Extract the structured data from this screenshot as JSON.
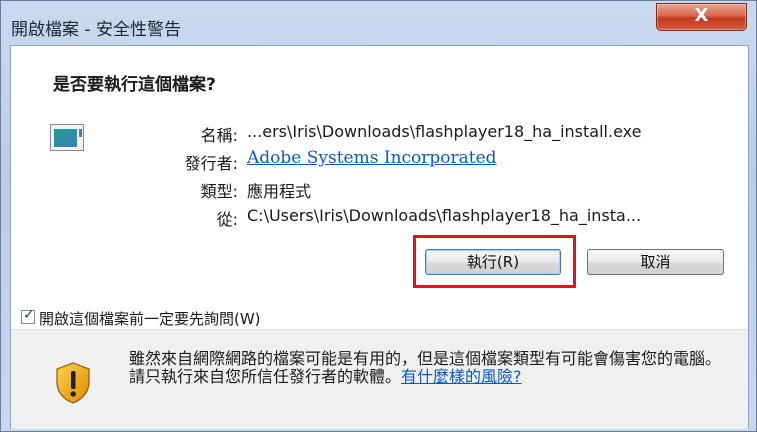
{
  "window": {
    "title": "開啟檔案 - 安全性警告",
    "close_label": "X"
  },
  "dialog": {
    "heading": "是否要執行這個檔案?",
    "file_icon": "application-window-icon",
    "fields": {
      "name_label": "名稱:",
      "name_value": "...ers\\Iris\\Downloads\\flashplayer18_ha_install.exe",
      "publisher_label": "發行者:",
      "publisher_value": "Adobe Systems Incorporated",
      "type_label": "類型:",
      "type_value": "應用程式",
      "from_label": "從:",
      "from_value": "C:\\Users\\Iris\\Downloads\\flashplayer18_ha_insta..."
    },
    "buttons": {
      "run_label": "執行(R)",
      "cancel_label": "取消"
    },
    "checkbox": {
      "label": "開啟這個檔案前一定要先詢問(W)",
      "checked": true
    },
    "warning": {
      "icon": "security-shield-icon",
      "text_part1": "雖然來自網際網路的檔案可能是有用的，但是這個檔案類型有可能會傷害您的電腦。請只執行來自您所信任發行者的軟體。",
      "link_text": "有什麼樣的風險?"
    }
  },
  "colors": {
    "highlight_box": "#e0141f",
    "link": "#0a58c7",
    "close_button": "#c2391f"
  }
}
